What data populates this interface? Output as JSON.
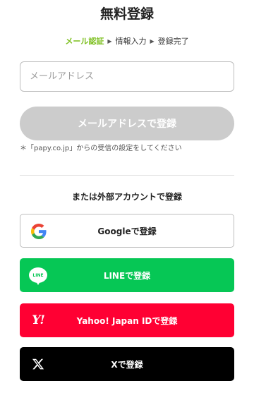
{
  "page_title": "無料登録",
  "steps": [
    {
      "label": "メール認証",
      "active": true
    },
    {
      "label": "情報入力",
      "active": false
    },
    {
      "label": "登録完了",
      "active": false
    }
  ],
  "email": {
    "placeholder": "メールアドレス",
    "value": ""
  },
  "submit_button": "メールアドレスで登録",
  "note": "＊「papy.co.jp」からの受信の設定をしてください",
  "external_heading": "または外部アカウントで登録",
  "sso": {
    "google": {
      "label": "Googleで登録",
      "icon": "google-logo-icon",
      "color": "#ffffff"
    },
    "line": {
      "label": "LINEで登録",
      "icon": "line-logo-icon",
      "logo_text": "LINE",
      "color": "#06c755"
    },
    "yahoo": {
      "label": "Yahoo! Japan IDで登録",
      "icon": "yahoo-logo-icon",
      "logo_text": "Y!",
      "color": "#ff0033"
    },
    "x": {
      "label": "Xで登録",
      "icon": "x-logo-icon",
      "color": "#000000"
    }
  },
  "colors": {
    "accent": "#7cbf1e",
    "disabled_button": "#cccccc"
  }
}
